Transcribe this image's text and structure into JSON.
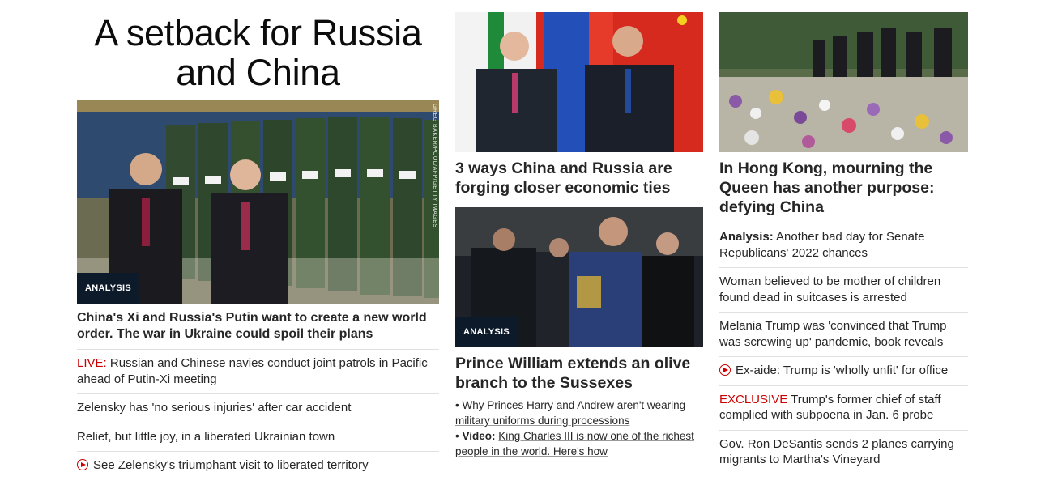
{
  "col1": {
    "title": "A setback for Russia and China",
    "photo_badge": "ANALYSIS",
    "photo_credit": "GREG BAKER/POOL/AFP/GETTY IMAGES",
    "headline": "China's Xi and Russia's Putin want to create a new world order. The war in Ukraine could spoil their plans",
    "links": [
      {
        "prefix": "LIVE:",
        "text": " Russian and Chinese navies conduct joint patrols in Pacific ahead of Putin-Xi meeting"
      },
      {
        "prefix": "",
        "text": "Zelensky has 'no serious injuries' after car accident"
      },
      {
        "prefix": "",
        "text": "Relief, but little joy, in a liberated Ukrainian town"
      },
      {
        "prefix": "",
        "text": "See Zelensky's triumphant visit to liberated territory",
        "video": true
      }
    ]
  },
  "col2": {
    "story1_headline": "3 ways China and Russia are forging closer economic ties",
    "story2_badge": "ANALYSIS",
    "story2_headline": "Prince William extends an olive branch to the Sussexes",
    "bullet1": "Why Princes Harry and Andrew aren't wearing military uniforms during processions",
    "bullet2_label": "Video:",
    "bullet2": "King Charles III is now one of the richest people in the world. Here's how"
  },
  "col3": {
    "headline": "In Hong Kong, mourning the Queen has another purpose: defying China",
    "links": [
      {
        "prefix": "Analysis:",
        "text": " Another bad day for Senate Republicans' 2022 chances"
      },
      {
        "prefix": "",
        "text": "Woman believed to be mother of children found dead in suitcases is arrested"
      },
      {
        "prefix": "",
        "text": "Melania Trump was 'convinced that Trump was screwing up' pandemic, book reveals"
      },
      {
        "prefix": "",
        "text": "Ex-aide: Trump is 'wholly unfit' for office",
        "video": true
      },
      {
        "prefix": "EXCLUSIVE",
        "text": " Trump's former chief of staff complied with subpoena in Jan. 6 probe"
      },
      {
        "prefix": "",
        "text": "Gov. Ron DeSantis sends 2 planes carrying migrants to Martha's Vineyard"
      }
    ]
  },
  "colors": {
    "accent_red": "#cc0000",
    "badge_bg": "#0c1a2a",
    "text": "#262626"
  }
}
